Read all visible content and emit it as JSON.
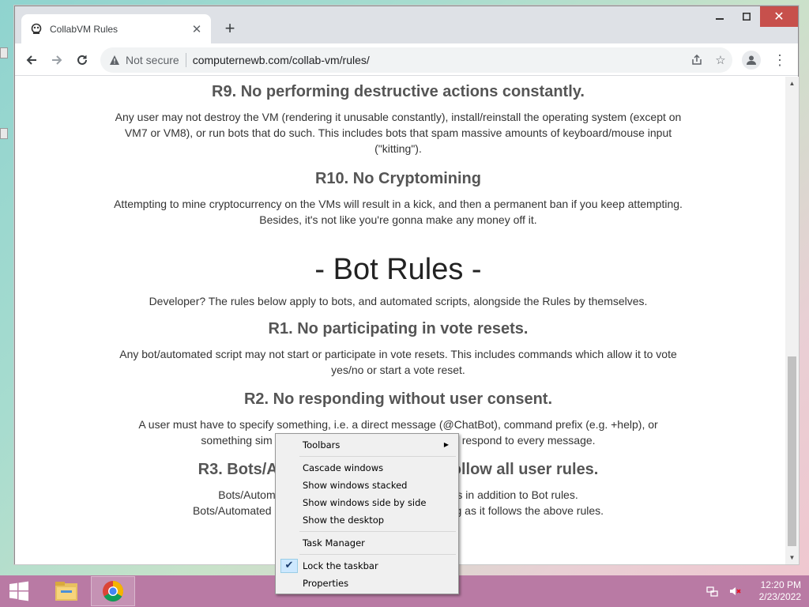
{
  "browser": {
    "tab_title": "CollabVM Rules",
    "not_secure": "Not secure",
    "url": "computernewb.com/collab-vm/rules/"
  },
  "content": {
    "r9": {
      "heading": "R9. No performing destructive actions constantly.",
      "text": "Any user may not destroy the VM (rendering it unusable constantly), install/reinstall the operating system (except on VM7 or VM8), or run bots that do such. This includes bots that spam massive amounts of keyboard/mouse input (\"kitting\")."
    },
    "r10": {
      "heading": "R10. No Cryptomining",
      "text": "Attempting to mine cryptocurrency on the VMs will result in a kick, and then a permanent ban if you keep attempting. Besides, it's not like you're gonna make any money off it."
    },
    "bot_rules": {
      "heading": "- Bot Rules -",
      "intro": "Developer? The rules below apply to bots, and automated scripts, alongside the Rules by themselves."
    },
    "b1": {
      "heading": "R1. No participating in vote resets.",
      "text": "Any bot/automated script may not start or participate in vote resets. This includes commands which allow it to vote yes/no or start a vote reset."
    },
    "b2": {
      "heading": "R2. No responding without user consent.",
      "line1": "A user must have to specify something, i.e. a direct message (@ChatBot), command prefix (e.g. +help), or",
      "line2_left": "something sim",
      "line2_right": "respond to every message."
    },
    "b3": {
      "heading_left": "R3. Bots/A",
      "heading_right": "ollow all user rules.",
      "line1_left": "Bots/Automa",
      "line1_right": "s in addition to Bot rules.",
      "line2_left": "Bots/Automated s",
      "line2_right": "g as it follows the above rules."
    }
  },
  "context_menu": {
    "toolbars": "Toolbars",
    "cascade": "Cascade windows",
    "stacked": "Show windows stacked",
    "side_by_side": "Show windows side by side",
    "desktop": "Show the desktop",
    "task_manager": "Task Manager",
    "lock_taskbar": "Lock the taskbar",
    "lock_checked": true,
    "properties": "Properties"
  },
  "taskbar": {
    "time": "12:20 PM",
    "date": "2/23/2022"
  },
  "colors": {
    "taskbar": "#b97aa4",
    "close_button": "#c7504c"
  }
}
